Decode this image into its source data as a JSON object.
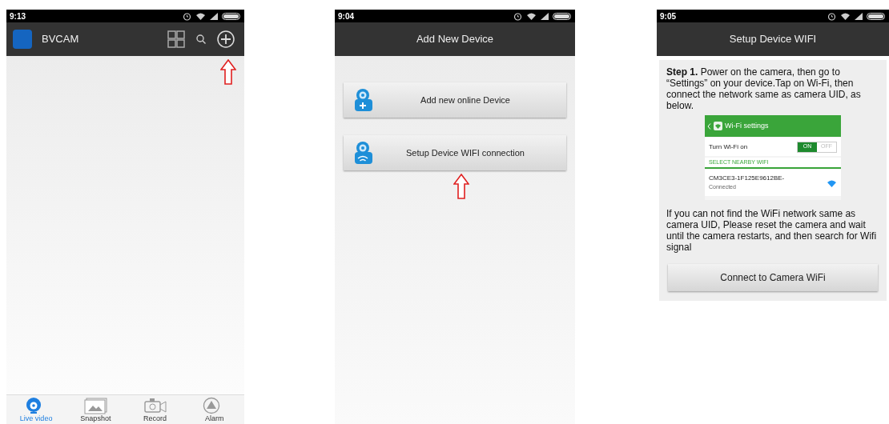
{
  "screens": [
    {
      "kind": "home",
      "status_time": "9:13",
      "app_name": "BVCAM",
      "nav": [
        {
          "label": "Live video",
          "kind": "live",
          "selected": true
        },
        {
          "label": "Snapshot",
          "kind": "snapshot",
          "selected": false
        },
        {
          "label": "Record",
          "kind": "record",
          "selected": false
        },
        {
          "label": "Alarm",
          "kind": "alarm",
          "selected": false
        }
      ]
    },
    {
      "kind": "add",
      "status_time": "9:04",
      "title": "Add New Device",
      "options": [
        {
          "label": "Add new online Device",
          "kind": "add"
        },
        {
          "label": "Setup Device WIFI connection",
          "kind": "wifi"
        }
      ]
    },
    {
      "kind": "setup",
      "status_time": "9:05",
      "title": "Setup Device WIFI",
      "step": "**Step 1.** Power on the camera, then go to “Settings” on your device.Tap on Wi-Fi, then connect the network same as camera UID, as below.",
      "inset": {
        "title": "Wi-Fi settings",
        "toggle_label": "Turn Wi-Fi on",
        "wifi_on": true,
        "on_text": "ON",
        "off_text": "OFF",
        "section": "SELECT NEARBY WIFI",
        "network": "CM3CE3-1F125E9612BE-",
        "network_status": "Connected"
      },
      "note": "If you can not find the WiFi network same as camera UID, Please reset the camera and wait until the camera restarts, and then search for Wifi signal",
      "button": "Connect to Camera WiFi"
    }
  ]
}
